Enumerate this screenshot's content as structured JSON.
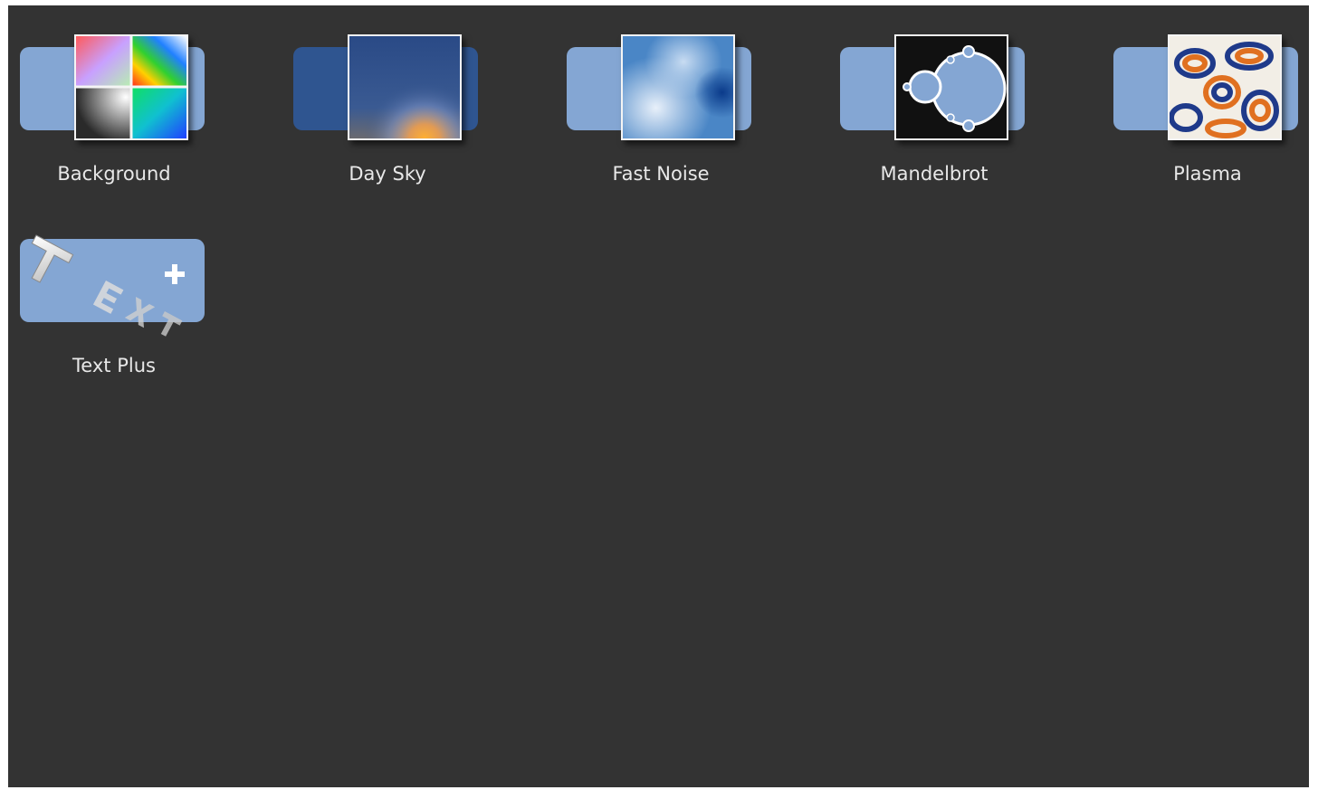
{
  "panel": {
    "background": "#333333"
  },
  "tiles": [
    {
      "label": "Background",
      "icon": "background-generator-icon"
    },
    {
      "label": "Day Sky",
      "icon": "day-sky-icon"
    },
    {
      "label": "Fast Noise",
      "icon": "fast-noise-icon"
    },
    {
      "label": "Mandelbrot",
      "icon": "mandelbrot-icon"
    },
    {
      "label": "Plasma",
      "icon": "plasma-icon"
    },
    {
      "label": "Text Plus",
      "icon": "text-plus-icon"
    }
  ],
  "colors": {
    "tile_bar": "#84a6d3",
    "tile_bar_dark": "#2f5590",
    "label_text": "#e8e8e8"
  }
}
